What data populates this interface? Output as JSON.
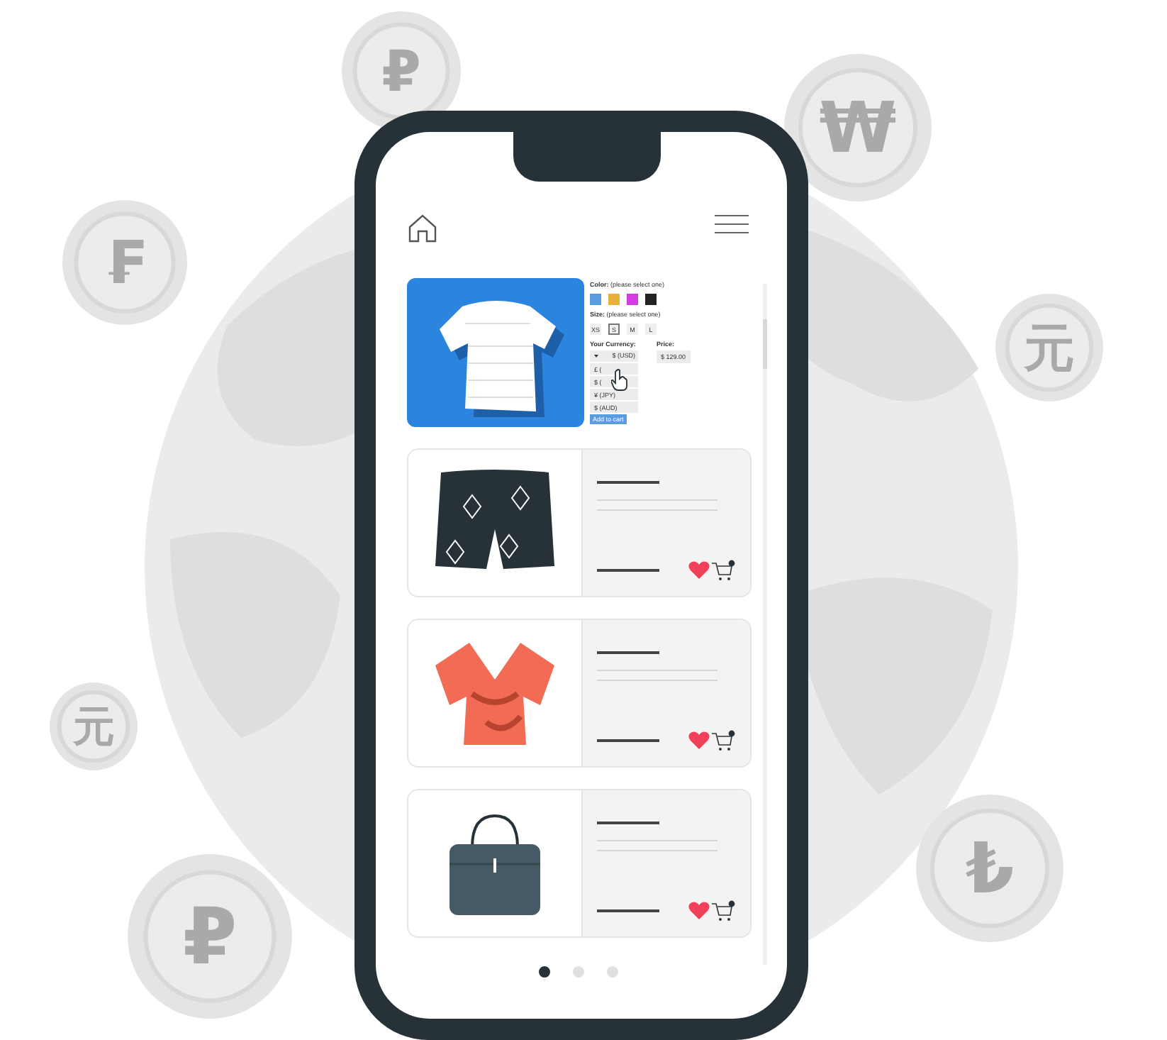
{
  "coins": [
    {
      "symbol": "₽"
    },
    {
      "symbol": "₩"
    },
    {
      "symbol": "₣"
    },
    {
      "symbol": "元"
    },
    {
      "symbol": "元"
    },
    {
      "symbol": "₺"
    },
    {
      "symbol": "₽"
    }
  ],
  "featured": {
    "color_label": "Color:",
    "color_hint": "(please select one)",
    "swatches": [
      {
        "color": "#5b9be0"
      },
      {
        "color": "#e8b13c"
      },
      {
        "color": "#d63ce0"
      },
      {
        "color": "#222222"
      }
    ],
    "size_label": "Size:",
    "size_hint": "(please select one)",
    "sizes": [
      {
        "label": "XS",
        "selected": false
      },
      {
        "label": "S",
        "selected": true
      },
      {
        "label": "M",
        "selected": false
      },
      {
        "label": "L",
        "selected": false
      }
    ],
    "currency_label": "Your Currency:",
    "currency_value": "$ (USD)",
    "currency_options": [
      "£ (",
      "$ (",
      "¥ (JPY)",
      "$ (AUD)"
    ],
    "price_label": "Price:",
    "price_value": "$ 129.00",
    "add_button": "Add to cart"
  },
  "products": [
    {
      "kind": "shorts"
    },
    {
      "kind": "blouse"
    },
    {
      "kind": "bag"
    }
  ],
  "pager": [
    {
      "selected": true
    },
    {
      "selected": false
    },
    {
      "selected": false
    }
  ]
}
